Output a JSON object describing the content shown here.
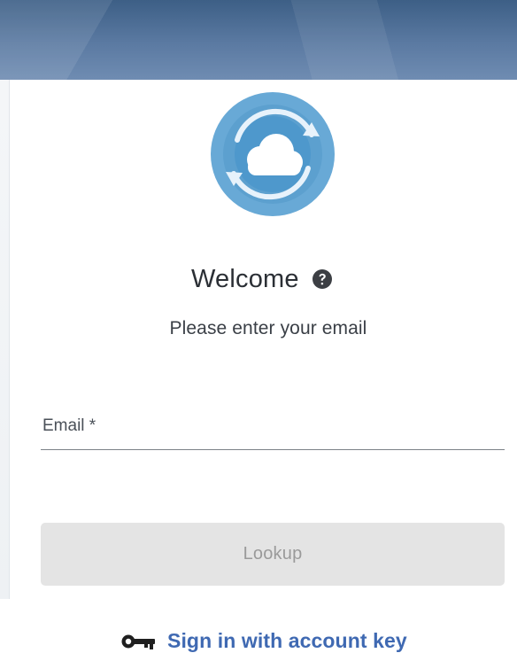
{
  "header": {
    "logo_icon": "cloud-sync-icon"
  },
  "welcome": {
    "title": "Welcome",
    "help_icon": "question-circle-icon",
    "subtitle": "Please enter your email"
  },
  "form": {
    "email_label": "Email *",
    "email_value": "",
    "email_placeholder": ""
  },
  "buttons": {
    "lookup_label": "Lookup"
  },
  "alternate_sign_in": {
    "icon": "key-icon",
    "label": "Sign in with account key"
  },
  "colors": {
    "banner": "#4f6f98",
    "link": "#3f69b2",
    "button_disabled_bg": "#e4e4e4",
    "button_disabled_text": "#9a9a9a"
  }
}
